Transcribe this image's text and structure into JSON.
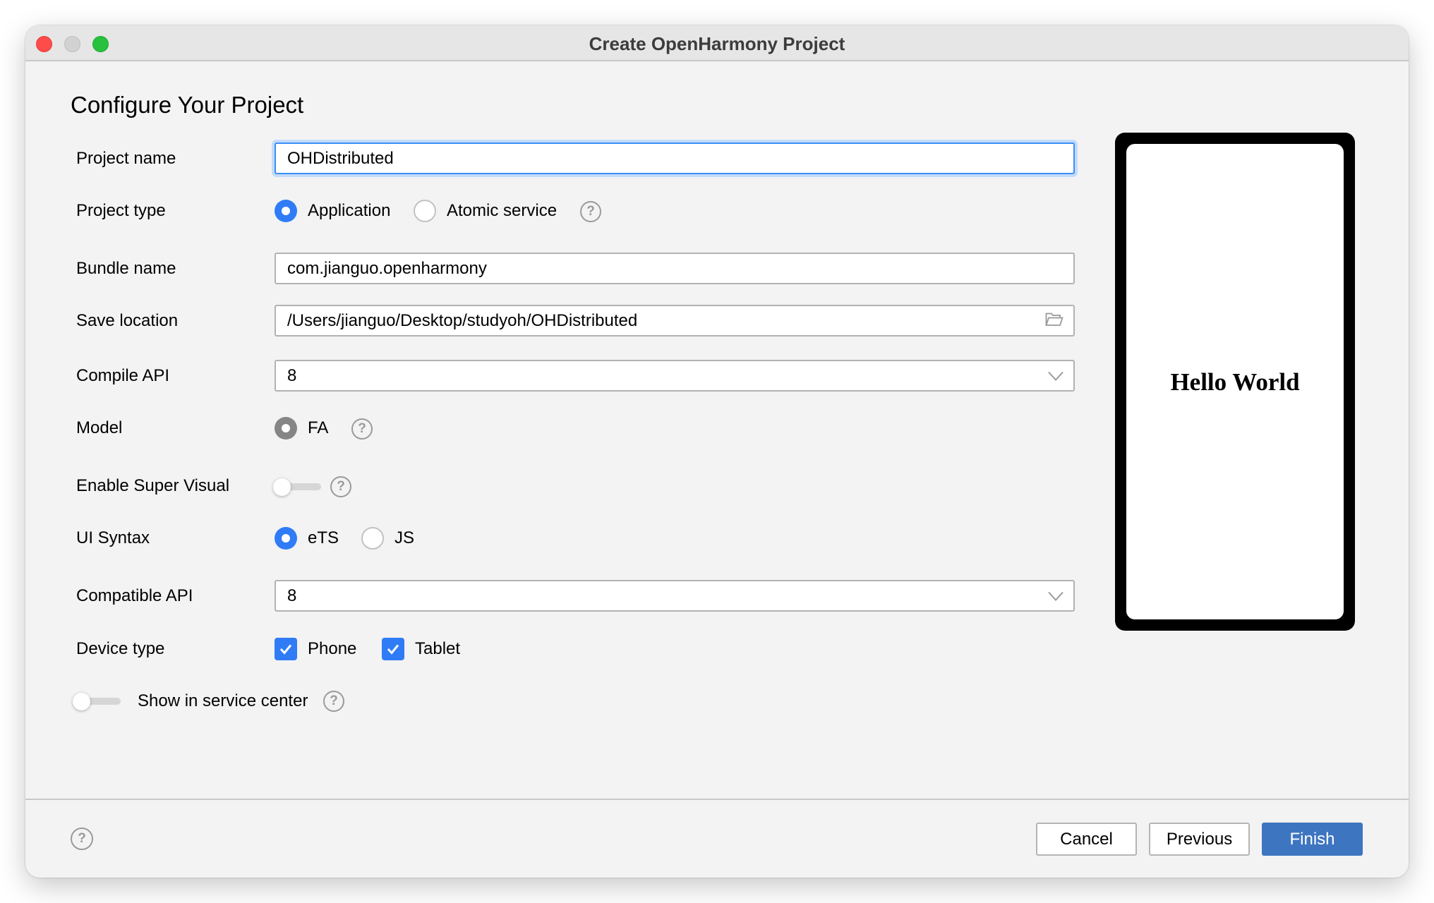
{
  "window": {
    "title": "Create OpenHarmony Project"
  },
  "page": {
    "heading": "Configure Your Project"
  },
  "form": {
    "project_name": {
      "label": "Project name",
      "value": "OHDistributed"
    },
    "project_type": {
      "label": "Project type",
      "options": [
        "Application",
        "Atomic service"
      ],
      "selected": "Application",
      "help_icon": "question-circle-icon"
    },
    "bundle_name": {
      "label": "Bundle name",
      "value": "com.jianguo.openharmony"
    },
    "save_location": {
      "label": "Save location",
      "value": "/Users/jianguo/Desktop/studyoh/OHDistributed",
      "icon": "folder-open-icon"
    },
    "compile_api": {
      "label": "Compile API",
      "value": "8",
      "icon": "chevron-down-icon"
    },
    "model": {
      "label": "Model",
      "options": [
        "FA"
      ],
      "selected": "FA",
      "help_icon": "question-circle-icon"
    },
    "enable_super_visual": {
      "label": "Enable Super Visual",
      "enabled": false,
      "help_icon": "question-circle-icon"
    },
    "ui_syntax": {
      "label": "UI Syntax",
      "options": [
        "eTS",
        "JS"
      ],
      "selected": "eTS"
    },
    "compatible_api": {
      "label": "Compatible API",
      "value": "8",
      "icon": "chevron-down-icon"
    },
    "device_type": {
      "label": "Device type",
      "options": [
        {
          "label": "Phone",
          "checked": true
        },
        {
          "label": "Tablet",
          "checked": true
        }
      ]
    },
    "show_in_service_center": {
      "label": "Show in service center",
      "enabled": false,
      "help_icon": "question-circle-icon"
    }
  },
  "preview": {
    "text": "Hello World"
  },
  "footer": {
    "help_icon": "question-circle-icon",
    "cancel_label": "Cancel",
    "previous_label": "Previous",
    "finish_label": "Finish"
  },
  "colors": {
    "accent": "#2f7cf6",
    "primary_button": "#3d75c1",
    "focus_ring": "#3a8ff7",
    "window_bg": "#f3f3f3",
    "titlebar_bg": "#e6e6e6"
  }
}
